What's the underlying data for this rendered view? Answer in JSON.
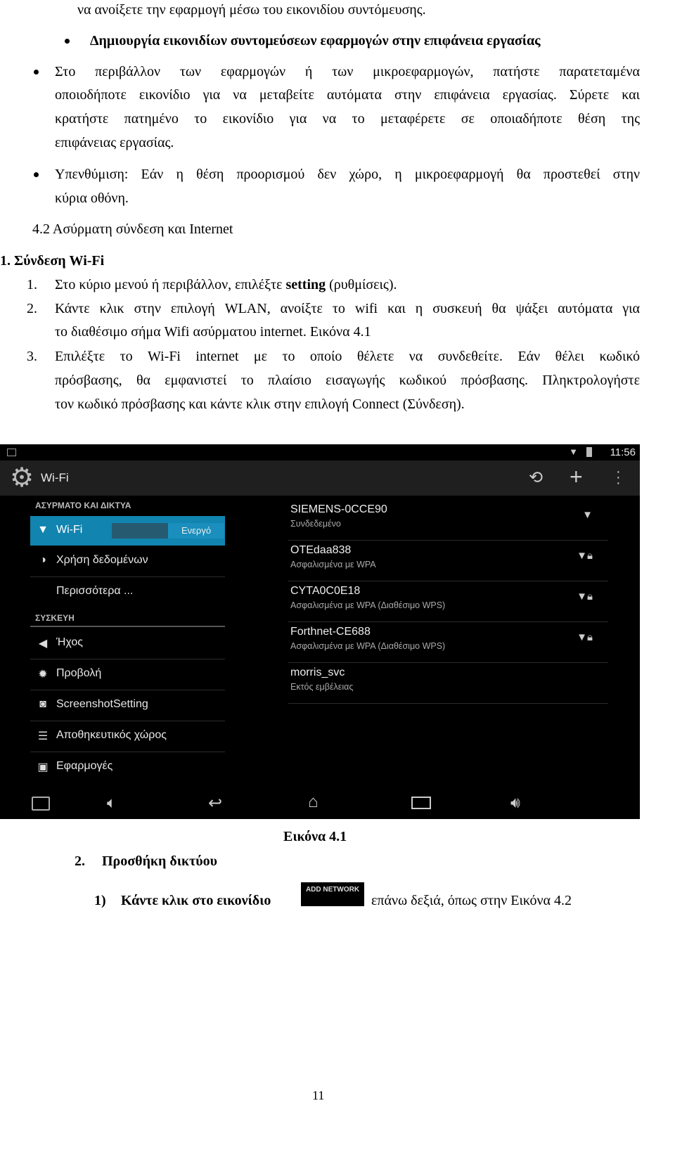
{
  "text": {
    "l0": "να ανοίξετε την εφαρμογή μέσω του εικονιδίου συντόμευσης.",
    "l1": "Δημιουργία εικονιδίων συντομεύσεων εφαρμογών στην επιφάνεια εργασίας",
    "l2a": "Στο περιβάλλον των εφαρμογών ή των μικροεφαρμογών, πατήστε παρατεταμένα",
    "l2b": "οποιοδήποτε εικονίδιο για να μεταβείτε αυτόματα στην επιφάνεια εργασίας. Σύρετε και",
    "l2c": "κρατήστε πατημένο το εικονίδιο για να το μεταφέρετε σε οποιαδήποτε θέση της",
    "l2d": "επιφάνειας εργασίας.",
    "l3a": "Υπενθύμιση: Εάν η θέση προορισμού δεν χώρο, η μικροεφαρμογή θα προστεθεί στην",
    "l3b": "κύρια οθόνη.",
    "h42": "4.2 Ασύρματη σύνδεση και Internet",
    "h1": "1. Σύνδεση Wi-Fi",
    "s1a": "1.",
    "s1b": "Στο κύριο μενού ή περιβάλλον, επιλέξτε ",
    "s1c": "setting",
    "s1d": " (ρυθμίσεις).",
    "s2n": "2.",
    "s2a": "Κάντε κλικ στην επιλογή WLAN, ανοίξτε το wifi και η συσκευή θα ψάξει αυτόματα για",
    "s2b": "το διαθέσιμο σήμα Wifi ασύρματου internet. Εικόνα 4.1",
    "s3n": "3.",
    "s3a": "Επιλέξτε το Wi-Fi internet με το οποίο θέλετε να συνδεθείτε. Εάν θέλει κωδικό",
    "s3b": "πρόσβασης, θα εμφανιστεί το πλαίσιο εισαγωγής κωδικού πρόσβασης. Πληκτρολογήστε",
    "s3c": "τον κωδικό πρόσβασης και κάντε κλικ στην επιλογή Connect (Σύνδεση).",
    "caption": "Εικόνα 4.1",
    "h2n": "2.",
    "h2": "Προσθήκη δικτύου",
    "i1n": "1)",
    "i1a": "Κάντε κλικ στο εικονίδιο",
    "i1btn": "ADD NETWORK",
    "i1b": "επάνω δεξιά, όπως στην Εικόνα 4.2",
    "page": "11"
  },
  "screen": {
    "time": "11:56",
    "title": "Wi-Fi",
    "accent": "#1184b0",
    "sec1": "ΑΣΥΡΜΑΤΟ ΚΑΙ ΔΙΚΤΥΑ",
    "wifi_label": "Wi-Fi",
    "wifi_toggle": "Ενεργό",
    "items1": [
      "Χρήση δεδομένων",
      "Περισσότερα ..."
    ],
    "sec2": "ΣΥΣΚΕΥΗ",
    "items2": [
      "Ήχος",
      "Προβολή",
      "ScreenshotSetting",
      "Αποθηκευτικός χώρος",
      "Εφαρμογές"
    ],
    "networks": [
      {
        "name": "SIEMENS-0CCE90",
        "status": "Συνδεδεμένο",
        "icon": "wifi-icon"
      },
      {
        "name": "OTEdaa838",
        "status": "Ασφαλισμένα με WPA",
        "icon": "wifi-lock-icon"
      },
      {
        "name": "CYTA0C0E18",
        "status": "Ασφαλισμένα με WPA (Διαθέσιμο WPS)",
        "icon": "wifi-lock-icon"
      },
      {
        "name": "Forthnet-CE688",
        "status": "Ασφαλισμένα με WPA (Διαθέσιμο WPS)",
        "icon": "wifi-lock-icon"
      },
      {
        "name": "morris_svc",
        "status": "Εκτός εμβέλειας",
        "icon": "wifi-icon"
      }
    ]
  }
}
